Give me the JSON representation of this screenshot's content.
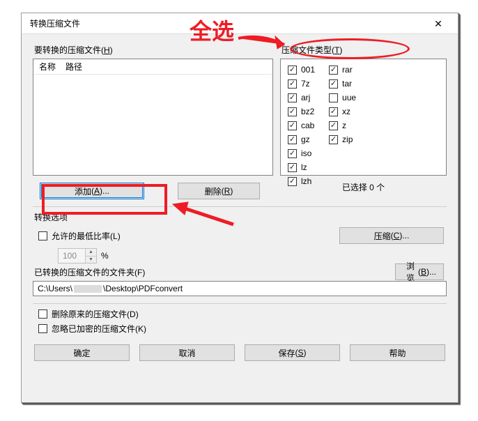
{
  "titlebar": {
    "title": "转换压缩文件"
  },
  "labels": {
    "files_to_convert": "要转换的压缩文件",
    "files_to_convert_key": "H",
    "archive_types": "压缩文件类型",
    "archive_types_key": "T",
    "col_name": "名称",
    "col_path": "路径",
    "selected_count": "已选择 0 个",
    "options_title": "转换选项",
    "min_ratio": "允许的最低比率",
    "min_ratio_key": "L",
    "ratio_value": "100",
    "percent": "%",
    "folder_label": "已转换的压缩文件的文件夹",
    "folder_key": "F",
    "folder_path_prefix": "C:\\Users\\",
    "folder_path_suffix": "\\Desktop\\PDFconvert",
    "delete_original": "删除原来的压缩文件",
    "delete_original_key": "D",
    "ignore_encrypted": "忽略已加密的压缩文件",
    "ignore_encrypted_key": "K"
  },
  "buttons": {
    "add": "添加",
    "add_key": "A",
    "add_ellipsis": "...",
    "delete": "删除",
    "delete_key": "R",
    "compress": "压缩",
    "compress_key": "C",
    "compress_ellipsis": "...",
    "browse": "浏览",
    "browse_key": "B",
    "browse_ellipsis": "...",
    "ok": "确定",
    "cancel": "取消",
    "save": "保存",
    "save_key": "S",
    "help": "帮助"
  },
  "types": {
    "col1": [
      {
        "label": "001",
        "checked": true
      },
      {
        "label": "7z",
        "checked": true
      },
      {
        "label": "arj",
        "checked": true
      },
      {
        "label": "bz2",
        "checked": true
      },
      {
        "label": "cab",
        "checked": true
      },
      {
        "label": "gz",
        "checked": true
      },
      {
        "label": "iso",
        "checked": true
      },
      {
        "label": "lz",
        "checked": true
      },
      {
        "label": "lzh",
        "checked": true
      }
    ],
    "col2": [
      {
        "label": "rar",
        "checked": true
      },
      {
        "label": "tar",
        "checked": true
      },
      {
        "label": "uue",
        "checked": false
      },
      {
        "label": "xz",
        "checked": true
      },
      {
        "label": "z",
        "checked": true
      },
      {
        "label": "zip",
        "checked": true
      }
    ]
  },
  "annotations": {
    "select_all": "全选"
  }
}
